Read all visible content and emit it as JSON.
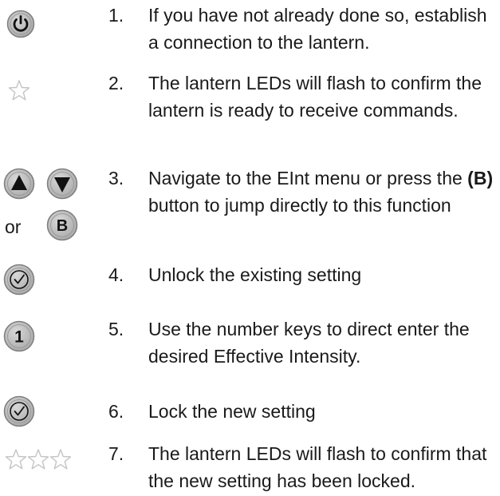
{
  "steps": [
    {
      "number": "1.",
      "text": "If you have not already done so, establish a connection to the lantern.",
      "icon": "power-button-icon"
    },
    {
      "number": "2.",
      "text": "The lantern LEDs will flash to confirm the lantern is ready to receive commands.",
      "icon": "star-icon"
    },
    {
      "number": "3.",
      "text_before": "Navigate to the EInt menu or press the ",
      "text_bold": "(B)",
      "text_after": " button to jump directly to this function",
      "or_label": "or",
      "icon": "up-down-arrows-and-b-button-icons"
    },
    {
      "number": "4.",
      "text": "Unlock the existing setting",
      "icon": "check-button-icon"
    },
    {
      "number": "5.",
      "text": "Use the number keys to direct enter the desired Effective Intensity.",
      "icon": "number-one-button-icon"
    },
    {
      "number": "6.",
      "text": "Lock the new setting",
      "icon": "check-button-icon"
    },
    {
      "number": "7.",
      "text": "The lantern LEDs will flash to confirm that the new setting has been locked.",
      "icon": "three-stars-icon"
    }
  ],
  "button_key_label": "1",
  "button_b_label": "B",
  "colors": {
    "button_fill": "#b9b9b9",
    "button_ring": "#8a8a8a",
    "glyph": "#111111",
    "star": "#c4c4c4"
  }
}
